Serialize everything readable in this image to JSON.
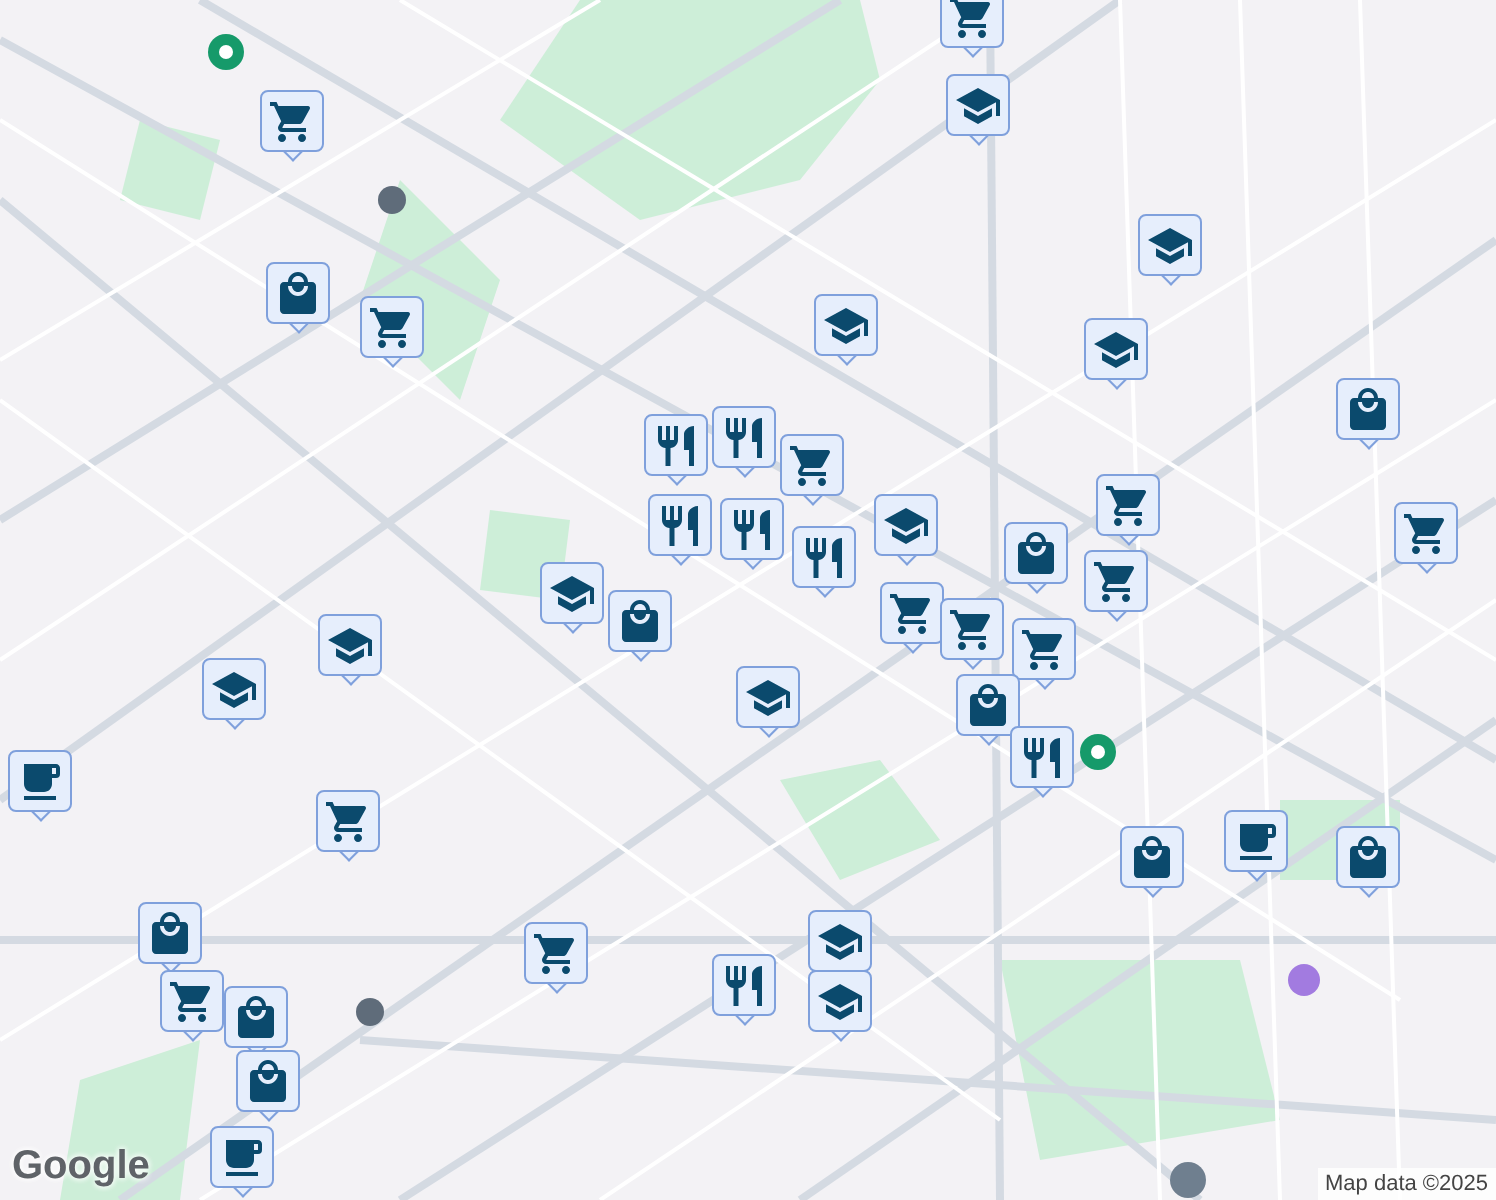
{
  "map": {
    "markers": [
      {
        "kind": "grocery"
      },
      {
        "kind": "grocery"
      },
      {
        "kind": "school"
      },
      {
        "kind": "shopping"
      },
      {
        "kind": "grocery"
      },
      {
        "kind": "school"
      },
      {
        "kind": "school"
      },
      {
        "kind": "school"
      },
      {
        "kind": "shopping"
      },
      {
        "kind": "restaurant"
      },
      {
        "kind": "restaurant"
      },
      {
        "kind": "restaurant"
      },
      {
        "kind": "grocery"
      },
      {
        "kind": "restaurant"
      },
      {
        "kind": "restaurant"
      },
      {
        "kind": "school"
      },
      {
        "kind": "grocery"
      },
      {
        "kind": "grocery"
      },
      {
        "kind": "grocery"
      },
      {
        "kind": "shopping"
      },
      {
        "kind": "grocery"
      },
      {
        "kind": "grocery"
      },
      {
        "kind": "grocery"
      },
      {
        "kind": "school"
      },
      {
        "kind": "shopping"
      },
      {
        "kind": "school"
      },
      {
        "kind": "school"
      },
      {
        "kind": "school"
      },
      {
        "kind": "shopping"
      },
      {
        "kind": "restaurant"
      },
      {
        "kind": "cafe"
      },
      {
        "kind": "grocery"
      },
      {
        "kind": "shopping"
      },
      {
        "kind": "cafe"
      },
      {
        "kind": "shopping"
      },
      {
        "kind": "shopping"
      },
      {
        "kind": "grocery"
      },
      {
        "kind": "school"
      },
      {
        "kind": "school"
      },
      {
        "kind": "restaurant"
      },
      {
        "kind": "grocery"
      },
      {
        "kind": "shopping"
      },
      {
        "kind": "shopping"
      },
      {
        "kind": "cafe"
      }
    ]
  },
  "logo": "Google",
  "attribution": "Map data ©2025"
}
